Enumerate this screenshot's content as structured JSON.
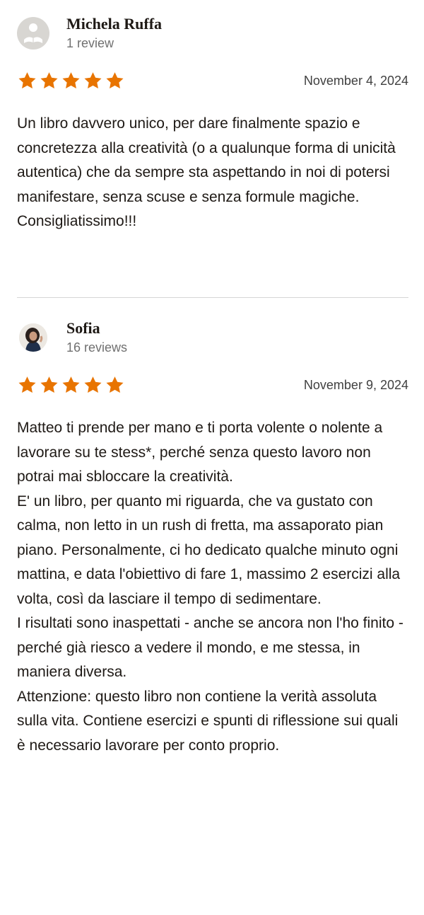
{
  "accent_star_color": "#e87400",
  "reviews": [
    {
      "reviewer_name": "Michela Ruffa",
      "review_count": "1 review",
      "avatar": "default-reader-icon",
      "rating": 5,
      "date": "November 4, 2024",
      "text": "Un libro davvero unico, per dare finalmente spazio e concretezza alla creatività (o a qualunque forma di unicità autentica) che da sempre sta aspettando in noi di potersi manifestare, senza scuse e senza formule magiche.\nConsigliatissimo!!!"
    },
    {
      "reviewer_name": "Sofia",
      "review_count": "16 reviews",
      "avatar": "user-photo",
      "rating": 5,
      "date": "November 9, 2024",
      "text": "Matteo ti prende per mano e ti porta volente o nolente a lavorare su te stess*, perché senza questo lavoro non potrai mai sbloccare la creatività.\nE' un libro, per quanto mi riguarda, che va gustato con calma, non letto in un rush di fretta, ma assaporato pian piano. Personalmente, ci ho dedicato qualche minuto ogni mattina, e data l'obiettivo di fare 1, massimo 2 esercizi alla volta, così da lasciare il tempo di sedimentare.\nI risultati sono inaspettati - anche se ancora non l'ho finito - perché già riesco a vedere il mondo, e me stessa, in maniera diversa.\nAttenzione: questo libro non contiene la verità assoluta sulla vita. Contiene esercizi e spunti di riflessione sui quali è necessario lavorare per conto proprio."
    }
  ]
}
